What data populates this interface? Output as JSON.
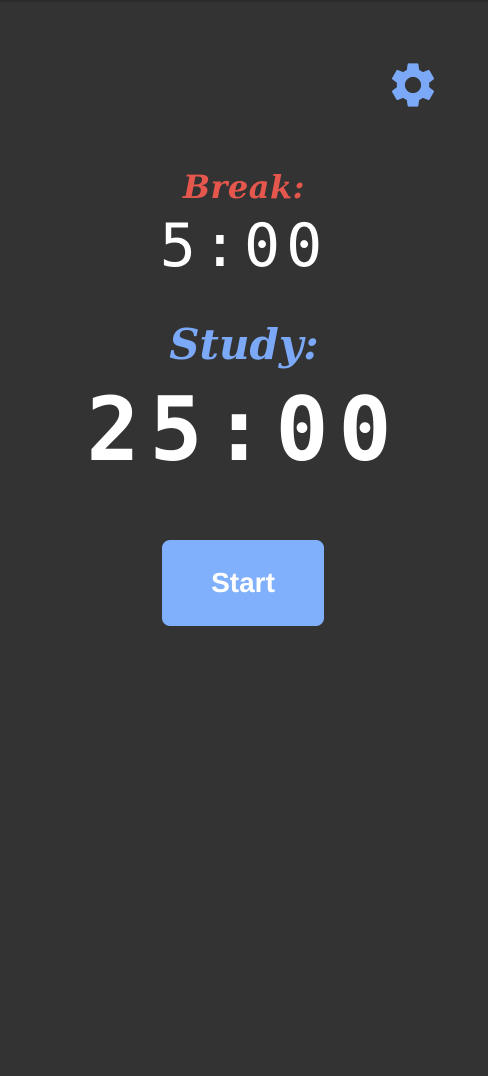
{
  "settings": {
    "icon": "gear-icon",
    "color": "#7ba9f7"
  },
  "timer": {
    "break_label": "Break:",
    "break_time": "5:00",
    "study_label": "Study:",
    "study_time": "25:00"
  },
  "actions": {
    "start_label": "Start"
  },
  "colors": {
    "background": "#333333",
    "break_accent": "#e5564d",
    "study_accent": "#7ba9f7",
    "button": "#80b0fb",
    "text": "#ffffff"
  }
}
